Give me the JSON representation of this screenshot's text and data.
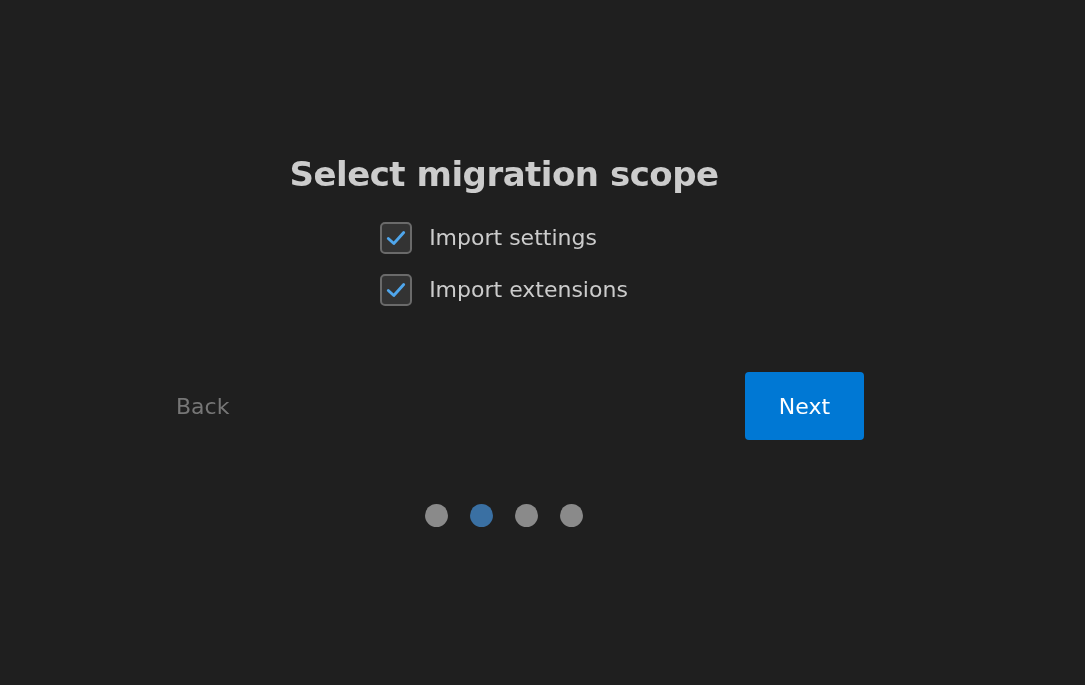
{
  "title": "Select migration scope",
  "options": [
    {
      "label": "Import settings",
      "checked": true
    },
    {
      "label": "Import extensions",
      "checked": true
    }
  ],
  "back_button": {
    "label": "Back",
    "disabled": true
  },
  "next_button": {
    "label": "Next"
  },
  "steps": [
    {
      "selected": false
    },
    {
      "selected": true
    },
    {
      "selected": false
    },
    {
      "selected": false
    }
  ]
}
